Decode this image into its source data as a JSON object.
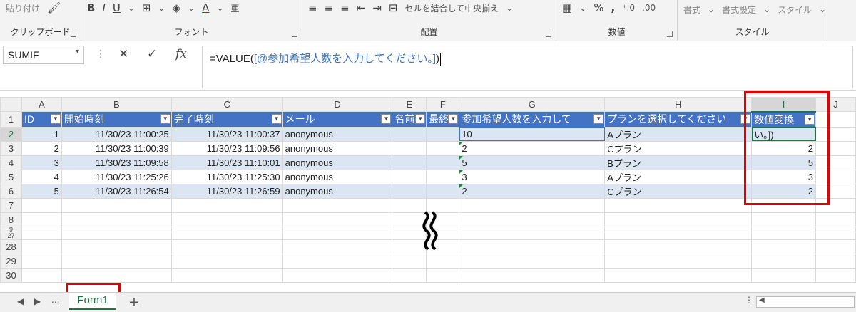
{
  "ribbon": {
    "clipboard": {
      "label": "クリップボード",
      "top_text": "貼り付け"
    },
    "font": {
      "label": "フォント"
    },
    "alignment": {
      "label": "配置",
      "merge_label": "セルを結合して中央揃え"
    },
    "number": {
      "label": "数値"
    },
    "styles": {
      "label": "スタイル",
      "cond_format": "書式",
      "table_format": "書式設定",
      "cell_styles": "スタイル"
    }
  },
  "formula_bar": {
    "name_box": "SUMIF",
    "formula_prefix": "=VALUE(",
    "formula_ref": "[@参加希望人数を入力してください。]",
    "formula_suffix": ")"
  },
  "columns": [
    "A",
    "B",
    "C",
    "D",
    "E",
    "F",
    "G",
    "H",
    "I",
    "J"
  ],
  "table": {
    "headers": [
      "ID",
      "開始時刻",
      "完了時刻",
      "メール",
      "名前",
      "最終",
      "参加希望人数を入力して",
      "プランを選択してください",
      "数値変換"
    ],
    "rows": [
      {
        "row": "2",
        "id": "1",
        "start": "11/30/23 11:00:25",
        "end": "11/30/23 11:00:37",
        "mail": "anonymous",
        "count": "10",
        "plan": "Aプラン",
        "conv": "い。])"
      },
      {
        "row": "3",
        "id": "2",
        "start": "11/30/23 11:00:39",
        "end": "11/30/23 11:09:56",
        "mail": "anonymous",
        "count": "2",
        "plan": "Cプラン",
        "conv": "2"
      },
      {
        "row": "4",
        "id": "3",
        "start": "11/30/23 11:09:58",
        "end": "11/30/23 11:10:01",
        "mail": "anonymous",
        "count": "5",
        "plan": "Bプラン",
        "conv": "5"
      },
      {
        "row": "5",
        "id": "4",
        "start": "11/30/23 11:25:26",
        "end": "11/30/23 11:25:30",
        "mail": "anonymous",
        "count": "3",
        "plan": "Aプラン",
        "conv": "3"
      },
      {
        "row": "6",
        "id": "5",
        "start": "11/30/23 11:26:54",
        "end": "11/30/23 11:26:59",
        "mail": "anonymous",
        "count": "2",
        "plan": "Cプラン",
        "conv": "2"
      }
    ],
    "header_row": "1",
    "empty_rows_top": [
      "7",
      "8",
      "9"
    ],
    "empty_rows_bottom": [
      "27",
      "28",
      "29",
      "30"
    ]
  },
  "sheet_tabs": {
    "active": "Form1",
    "more": "...",
    "add": "+"
  },
  "colors": {
    "table_header": "#4472c4",
    "band": "#dce6f2",
    "excel_green": "#217346",
    "highlight": "#e00000"
  }
}
